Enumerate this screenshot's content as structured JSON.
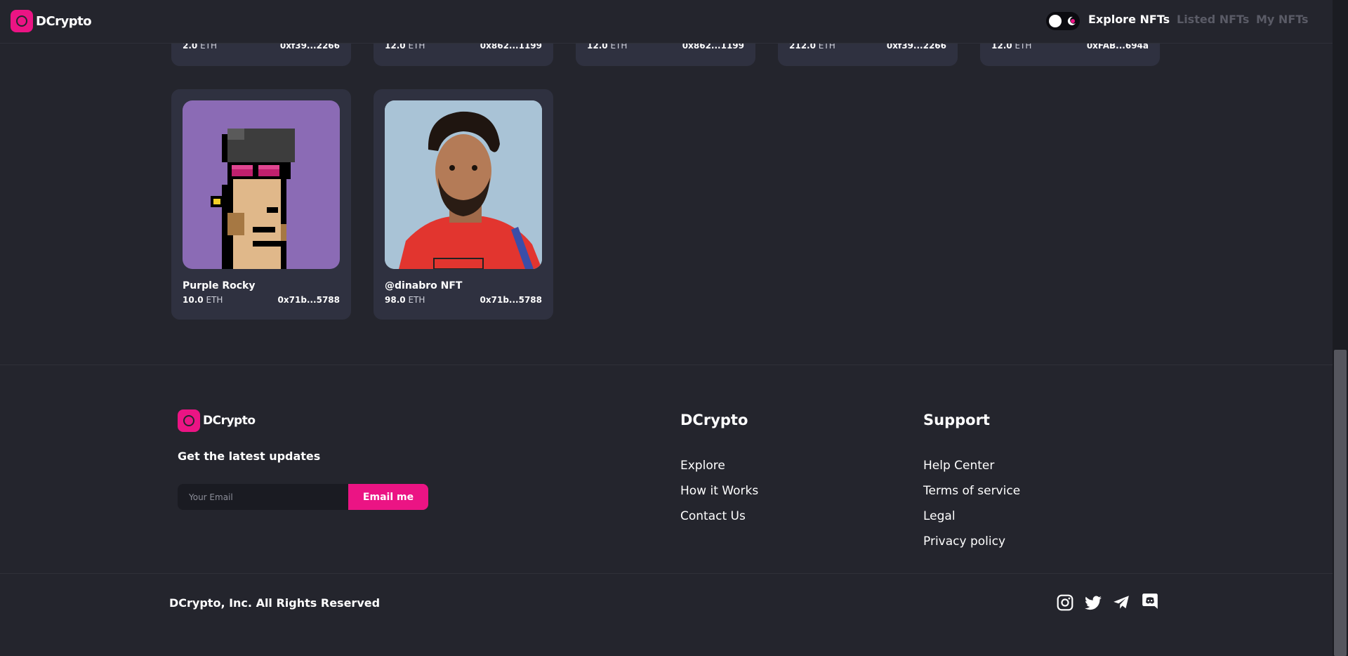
{
  "header": {
    "brand": "DCrypto",
    "nav": [
      "Explore NFTs",
      "Listed NFTs",
      "My NFTs"
    ]
  },
  "top_cards": [
    {
      "price": "2.0",
      "unit": "ETH",
      "address": "0xf39...2266"
    },
    {
      "price": "12.0",
      "unit": "ETH",
      "address": "0x862...1199"
    },
    {
      "price": "12.0",
      "unit": "ETH",
      "address": "0x862...1199"
    },
    {
      "price": "212.0",
      "unit": "ETH",
      "address": "0xf39...2266"
    },
    {
      "price": "12.0",
      "unit": "ETH",
      "address": "0xFAB...694a"
    }
  ],
  "cards": [
    {
      "title": "Purple Rocky",
      "price": "10.0",
      "unit": "ETH",
      "address": "0x71b...5788"
    },
    {
      "title": "@dinabro NFT",
      "price": "98.0",
      "unit": "ETH",
      "address": "0x71b...5788"
    }
  ],
  "footer": {
    "brand": "DCrypto",
    "subscribe_title": "Get the latest updates",
    "email_placeholder": "Your Email",
    "email_button": "Email me",
    "col1_title": "DCrypto",
    "col1_links": [
      "Explore",
      "How it Works",
      "Contact Us"
    ],
    "col2_title": "Support",
    "col2_links": [
      "Help Center",
      "Terms of service",
      "Legal",
      "Privacy policy"
    ],
    "copyright": "DCrypto, Inc. All Rights Reserved",
    "social_icons": [
      "instagram-icon",
      "twitter-icon",
      "telegram-icon",
      "discord-icon"
    ]
  },
  "colors": {
    "background": "#24252d",
    "card": "#2f3140",
    "accent": "#eb1484",
    "muted_nav": "#5a5b66"
  }
}
